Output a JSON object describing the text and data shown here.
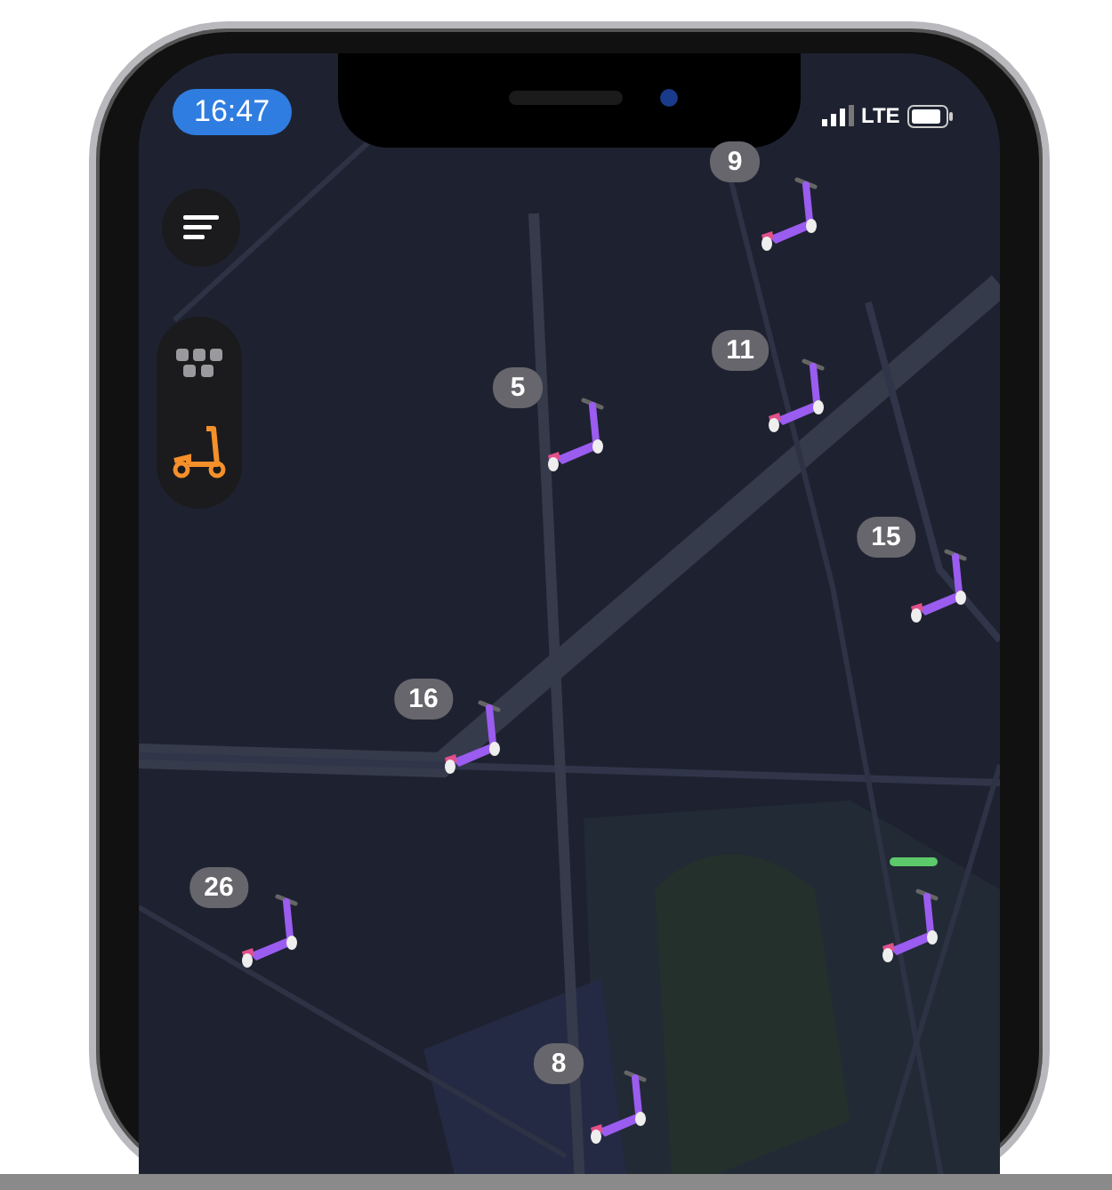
{
  "status_bar": {
    "time": "16:47",
    "network": "LTE"
  },
  "mode_switch": [
    {
      "kind": "taxi",
      "selected": false
    },
    {
      "kind": "scooter",
      "selected": true
    }
  ],
  "clusters": [
    {
      "count": "9"
    },
    {
      "count": "5"
    },
    {
      "count": "11"
    },
    {
      "count": "15"
    },
    {
      "count": "16"
    },
    {
      "count": "26"
    },
    {
      "count": "8"
    }
  ]
}
